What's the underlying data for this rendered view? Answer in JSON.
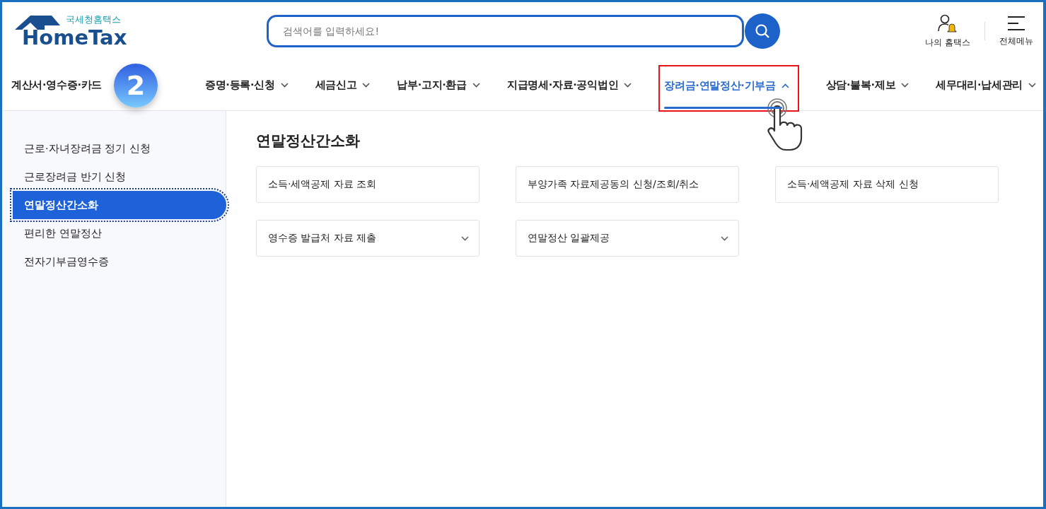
{
  "header": {
    "logo_subtitle": "국세청홈택스",
    "logo_title": "HomeTax",
    "search": {
      "placeholder": "검색어를 입력하세요!"
    },
    "my_hometax": "나의 홈택스",
    "all_menu": "전체메뉴"
  },
  "step_badge": "2",
  "nav": [
    {
      "label": "계산서·영수증·카드",
      "selected": false
    },
    {
      "label": "증명·등록·신청",
      "selected": false,
      "expanded": false
    },
    {
      "label": "세금신고",
      "selected": false,
      "expanded": false
    },
    {
      "label": "납부·고지·환급",
      "selected": false,
      "expanded": false
    },
    {
      "label": "지급명세·자료·공익법인",
      "selected": false,
      "expanded": false
    },
    {
      "label": "장려금·연말정산·기부금",
      "selected": true,
      "expanded": true
    },
    {
      "label": "상담·불복·제보",
      "selected": false,
      "expanded": false
    },
    {
      "label": "세무대리·납세관리",
      "selected": false,
      "expanded": false
    }
  ],
  "sidebar": {
    "items": [
      {
        "label": "근로·자녀장려금 정기 신청",
        "selected": false
      },
      {
        "label": "근로장려금 반기 신청",
        "selected": false
      },
      {
        "label": "연말정산간소화",
        "selected": true
      },
      {
        "label": "편리한 연말정산",
        "selected": false
      },
      {
        "label": "전자기부금영수증",
        "selected": false
      }
    ]
  },
  "content": {
    "title": "연말정산간소화",
    "cards": [
      {
        "label": "소득·세액공제 자료 조회",
        "kind": "link"
      },
      {
        "label": "부양가족 자료제공동의 신청/조회/취소",
        "kind": "link"
      },
      {
        "label": "소득·세액공제 자료 삭제 신청",
        "kind": "link"
      },
      {
        "label": "영수증 발급처 자료 제출",
        "kind": "dropdown"
      },
      {
        "label": "연말정산 일괄제공",
        "kind": "dropdown"
      }
    ]
  }
}
